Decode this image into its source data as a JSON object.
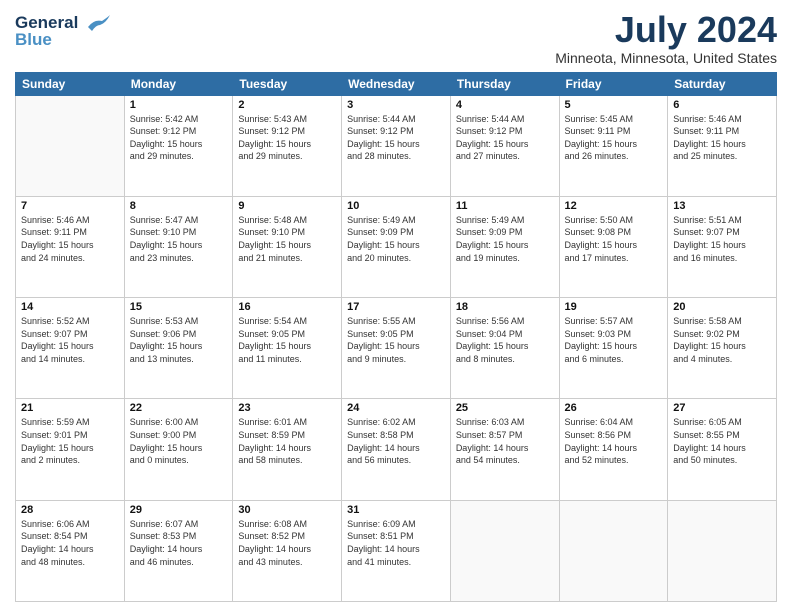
{
  "header": {
    "logo_line1": "General",
    "logo_line2": "Blue",
    "month": "July 2024",
    "location": "Minneota, Minnesota, United States"
  },
  "weekdays": [
    "Sunday",
    "Monday",
    "Tuesday",
    "Wednesday",
    "Thursday",
    "Friday",
    "Saturday"
  ],
  "weeks": [
    [
      {
        "day": "",
        "info": ""
      },
      {
        "day": "1",
        "info": "Sunrise: 5:42 AM\nSunset: 9:12 PM\nDaylight: 15 hours\nand 29 minutes."
      },
      {
        "day": "2",
        "info": "Sunrise: 5:43 AM\nSunset: 9:12 PM\nDaylight: 15 hours\nand 29 minutes."
      },
      {
        "day": "3",
        "info": "Sunrise: 5:44 AM\nSunset: 9:12 PM\nDaylight: 15 hours\nand 28 minutes."
      },
      {
        "day": "4",
        "info": "Sunrise: 5:44 AM\nSunset: 9:12 PM\nDaylight: 15 hours\nand 27 minutes."
      },
      {
        "day": "5",
        "info": "Sunrise: 5:45 AM\nSunset: 9:11 PM\nDaylight: 15 hours\nand 26 minutes."
      },
      {
        "day": "6",
        "info": "Sunrise: 5:46 AM\nSunset: 9:11 PM\nDaylight: 15 hours\nand 25 minutes."
      }
    ],
    [
      {
        "day": "7",
        "info": "Sunrise: 5:46 AM\nSunset: 9:11 PM\nDaylight: 15 hours\nand 24 minutes."
      },
      {
        "day": "8",
        "info": "Sunrise: 5:47 AM\nSunset: 9:10 PM\nDaylight: 15 hours\nand 23 minutes."
      },
      {
        "day": "9",
        "info": "Sunrise: 5:48 AM\nSunset: 9:10 PM\nDaylight: 15 hours\nand 21 minutes."
      },
      {
        "day": "10",
        "info": "Sunrise: 5:49 AM\nSunset: 9:09 PM\nDaylight: 15 hours\nand 20 minutes."
      },
      {
        "day": "11",
        "info": "Sunrise: 5:49 AM\nSunset: 9:09 PM\nDaylight: 15 hours\nand 19 minutes."
      },
      {
        "day": "12",
        "info": "Sunrise: 5:50 AM\nSunset: 9:08 PM\nDaylight: 15 hours\nand 17 minutes."
      },
      {
        "day": "13",
        "info": "Sunrise: 5:51 AM\nSunset: 9:07 PM\nDaylight: 15 hours\nand 16 minutes."
      }
    ],
    [
      {
        "day": "14",
        "info": "Sunrise: 5:52 AM\nSunset: 9:07 PM\nDaylight: 15 hours\nand 14 minutes."
      },
      {
        "day": "15",
        "info": "Sunrise: 5:53 AM\nSunset: 9:06 PM\nDaylight: 15 hours\nand 13 minutes."
      },
      {
        "day": "16",
        "info": "Sunrise: 5:54 AM\nSunset: 9:05 PM\nDaylight: 15 hours\nand 11 minutes."
      },
      {
        "day": "17",
        "info": "Sunrise: 5:55 AM\nSunset: 9:05 PM\nDaylight: 15 hours\nand 9 minutes."
      },
      {
        "day": "18",
        "info": "Sunrise: 5:56 AM\nSunset: 9:04 PM\nDaylight: 15 hours\nand 8 minutes."
      },
      {
        "day": "19",
        "info": "Sunrise: 5:57 AM\nSunset: 9:03 PM\nDaylight: 15 hours\nand 6 minutes."
      },
      {
        "day": "20",
        "info": "Sunrise: 5:58 AM\nSunset: 9:02 PM\nDaylight: 15 hours\nand 4 minutes."
      }
    ],
    [
      {
        "day": "21",
        "info": "Sunrise: 5:59 AM\nSunset: 9:01 PM\nDaylight: 15 hours\nand 2 minutes."
      },
      {
        "day": "22",
        "info": "Sunrise: 6:00 AM\nSunset: 9:00 PM\nDaylight: 15 hours\nand 0 minutes."
      },
      {
        "day": "23",
        "info": "Sunrise: 6:01 AM\nSunset: 8:59 PM\nDaylight: 14 hours\nand 58 minutes."
      },
      {
        "day": "24",
        "info": "Sunrise: 6:02 AM\nSunset: 8:58 PM\nDaylight: 14 hours\nand 56 minutes."
      },
      {
        "day": "25",
        "info": "Sunrise: 6:03 AM\nSunset: 8:57 PM\nDaylight: 14 hours\nand 54 minutes."
      },
      {
        "day": "26",
        "info": "Sunrise: 6:04 AM\nSunset: 8:56 PM\nDaylight: 14 hours\nand 52 minutes."
      },
      {
        "day": "27",
        "info": "Sunrise: 6:05 AM\nSunset: 8:55 PM\nDaylight: 14 hours\nand 50 minutes."
      }
    ],
    [
      {
        "day": "28",
        "info": "Sunrise: 6:06 AM\nSunset: 8:54 PM\nDaylight: 14 hours\nand 48 minutes."
      },
      {
        "day": "29",
        "info": "Sunrise: 6:07 AM\nSunset: 8:53 PM\nDaylight: 14 hours\nand 46 minutes."
      },
      {
        "day": "30",
        "info": "Sunrise: 6:08 AM\nSunset: 8:52 PM\nDaylight: 14 hours\nand 43 minutes."
      },
      {
        "day": "31",
        "info": "Sunrise: 6:09 AM\nSunset: 8:51 PM\nDaylight: 14 hours\nand 41 minutes."
      },
      {
        "day": "",
        "info": ""
      },
      {
        "day": "",
        "info": ""
      },
      {
        "day": "",
        "info": ""
      }
    ]
  ]
}
